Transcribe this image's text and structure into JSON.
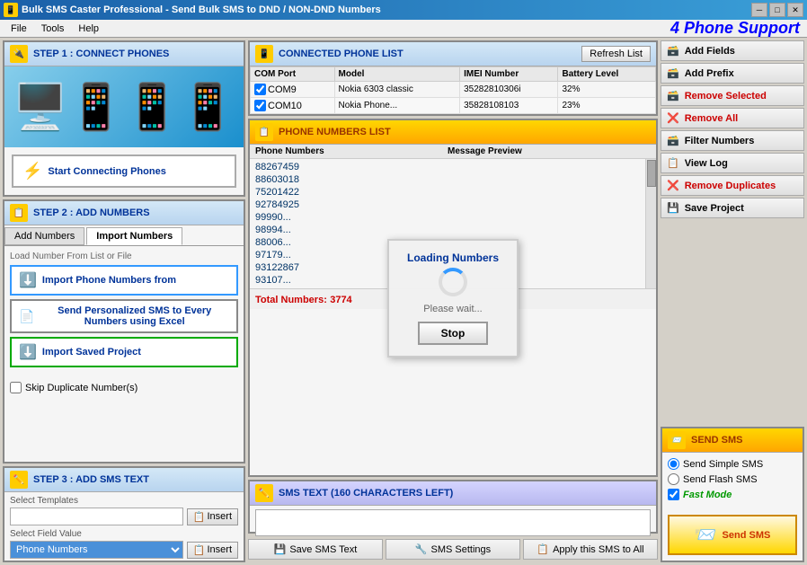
{
  "titleBar": {
    "title": "Bulk SMS Caster Professional - Send Bulk SMS to DND / NON-DND Numbers",
    "minimize": "─",
    "maximize": "□",
    "close": "✕"
  },
  "menu": {
    "items": [
      "File",
      "Tools",
      "Help"
    ],
    "phoneSupport": "4 Phone Support"
  },
  "step1": {
    "header": "STEP 1 : CONNECT PHONES",
    "btnLabel": "Start Connecting Phones"
  },
  "connectedPhoneList": {
    "header": "CONNECTED PHONE LIST",
    "refreshBtn": "Refresh List",
    "columns": [
      "COM  Port",
      "Model",
      "IMEI Number",
      "Battery Level"
    ],
    "rows": [
      {
        "com": "COM9",
        "model": "Nokia 6303 classic",
        "imei": "35282810306i",
        "battery": "32%",
        "checked": true
      },
      {
        "com": "COM10",
        "model": "Nokia Phone...",
        "imei": "35828108103",
        "battery": "23%",
        "checked": true
      }
    ]
  },
  "step2": {
    "header": "STEP 2 : ADD NUMBERS",
    "tabs": [
      "Add Numbers",
      "Import Numbers"
    ],
    "loadLabel": "Load Number From List or File",
    "importBtn": "Import Phone Numbers from",
    "excelBtn": "Send Personalized SMS to Every Numbers using Excel",
    "savedProjectBtn": "Import Saved Project",
    "skipDuplicate": "Skip Duplicate Number(s)"
  },
  "phoneNumbersList": {
    "header": "PHONE NUMBERS LIST",
    "colNumbers": "Phone Numbers",
    "colPreview": "Message Preview",
    "numbers": [
      "88267459",
      "88603018",
      "75201422",
      "92784925",
      "99990...",
      "98994...",
      "88006...",
      "97179...",
      "93122867",
      "93107..."
    ],
    "totalLabel": "Total Numbers:",
    "totalValue": "3774",
    "loading": {
      "title": "Loading Numbers",
      "message": "Please wait...",
      "stopBtn": "Stop"
    }
  },
  "rightActions": {
    "addFields": "Add Fields",
    "addPrefix": "Add Prefix",
    "removeSelected": "Remove Selected",
    "removeAll": "Remove All",
    "filterNumbers": "Filter Numbers",
    "viewLog": "View Log",
    "removeDuplicates": "Remove Duplicates",
    "saveProject": "Save Project"
  },
  "smsText": {
    "header": "SMS TEXT (160 CHARACTERS LEFT)"
  },
  "step3": {
    "header": "STEP 3 : ADD SMS TEXT",
    "selectTemplates": "Select Templates",
    "insertBtn": "Insert",
    "selectFieldValue": "Select Field Value",
    "fieldValueOption": "Phone Numbers",
    "insertBtn2": "Insert"
  },
  "sendSms": {
    "header": "SEND SMS",
    "simpleSms": "Send Simple SMS",
    "flashSms": "Send Flash SMS",
    "fastMode": "Fast Mode",
    "sendBtn": "Send SMS"
  },
  "bottomBar": {
    "saveSmsText": "Save SMS Text",
    "smsSettings": "SMS Settings",
    "applyToAll": "Apply this SMS to All"
  }
}
